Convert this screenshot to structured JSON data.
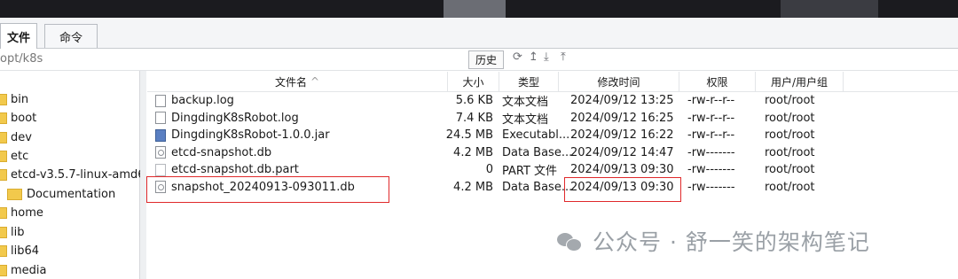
{
  "tabs": [
    {
      "label": "文件",
      "active": true
    },
    {
      "label": "命令",
      "active": false
    }
  ],
  "path": "opt/k8s",
  "toolbar": {
    "history_label": "历史",
    "refresh_icon": "refresh-icon",
    "up_icon": "up-icon",
    "download_icon": "download-icon",
    "upload_icon": "upload-icon"
  },
  "tree": {
    "items": [
      "bin",
      "boot",
      "dev",
      "etc",
      "etcd-v3.5.7-linux-amd6",
      "Documentation",
      "home",
      "lib",
      "lib64",
      "media"
    ]
  },
  "columns": [
    "文件名",
    "大小",
    "类型",
    "修改时间",
    "权限",
    "用户/用户组"
  ],
  "sort_indicator": "^",
  "files": [
    {
      "name": "backup.log",
      "size": "5.6 KB",
      "type": "文本文档",
      "modified": "2024/09/12 13:25",
      "perm": "-rw-r--r--",
      "owner": "root/root",
      "icon": "log"
    },
    {
      "name": "DingdingK8sRobot.log",
      "size": "7.4 KB",
      "type": "文本文档",
      "modified": "2024/09/12 16:25",
      "perm": "-rw-r--r--",
      "owner": "root/root",
      "icon": "log"
    },
    {
      "name": "DingdingK8sRobot-1.0.0.jar",
      "size": "24.5 MB",
      "type": "Executabl...",
      "modified": "2024/09/12 16:22",
      "perm": "-rw-r--r--",
      "owner": "root/root",
      "icon": "jar"
    },
    {
      "name": "etcd-snapshot.db",
      "size": "4.2 MB",
      "type": "Data Base...",
      "modified": "2024/09/12 14:47",
      "perm": "-rw-------",
      "owner": "root/root",
      "icon": "db"
    },
    {
      "name": "etcd-snapshot.db.part",
      "size": "0",
      "type": "PART 文件",
      "modified": "2024/09/13 09:30",
      "perm": "-rw-------",
      "owner": "root/root",
      "icon": "blank"
    },
    {
      "name": "snapshot_20240913-093011.db",
      "size": "4.2 MB",
      "type": "Data Base...",
      "modified": "2024/09/13 09:30",
      "perm": "-rw-------",
      "owner": "root/root",
      "icon": "db"
    }
  ],
  "watermark": "公众号 · 舒一笑的架构笔记",
  "colors": {
    "highlight": "#e0292b",
    "folder": "#f2c94c"
  }
}
